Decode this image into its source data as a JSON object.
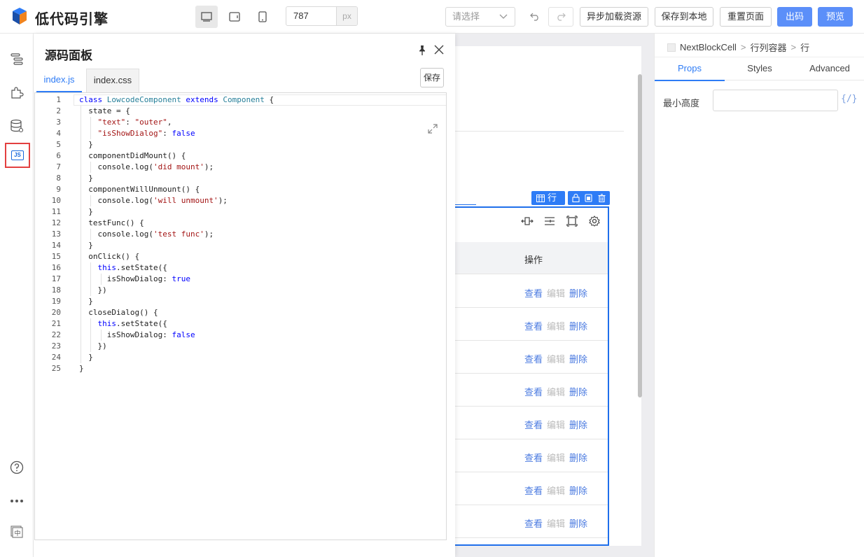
{
  "app": {
    "title": "低代码引擎"
  },
  "toolbar": {
    "width_value": "787",
    "width_unit": "px",
    "select_placeholder": "请选择",
    "async_load": "异步加载资源",
    "save_local": "保存到本地",
    "reset_page": "重置页面",
    "export": "出码",
    "preview": "预览"
  },
  "source_panel": {
    "title": "源码面板",
    "tabs": [
      "index.js",
      "index.css"
    ],
    "save_label": "保存",
    "code_lines": [
      "class LowcodeComponent extends Component {",
      "  state = {",
      "    \"text\": \"outer\",",
      "    \"isShowDialog\": false",
      "  }",
      "  componentDidMount() {",
      "    console.log('did mount');",
      "  }",
      "  componentWillUnmount() {",
      "    console.log('will unmount');",
      "  }",
      "  testFunc() {",
      "    console.log('test func');",
      "  }",
      "  onClick() {",
      "    this.setState({",
      "      isShowDialog: true",
      "    })",
      "  }",
      "  closeDialog() {",
      "    this.setState({",
      "      isShowDialog: false",
      "    })",
      "  }",
      "}"
    ]
  },
  "canvas": {
    "row_badge": "行",
    "table_header": "操作",
    "row_ops": {
      "view": "查看",
      "edit": "编辑",
      "delete": "删除"
    },
    "row_count": 8
  },
  "right_panel": {
    "breadcrumb": [
      "NextBlockCell",
      "行列容器",
      "行"
    ],
    "tabs": [
      "Props",
      "Styles",
      "Advanced"
    ],
    "active_tab": "Props",
    "min_height_label": "最小高度",
    "min_height_value": "",
    "var_bind": "{/}"
  },
  "colors": {
    "primary": "#5b8ff9",
    "accent": "#2e7cf6",
    "link": "#4a7ae0",
    "highlight_border": "#e34040"
  }
}
